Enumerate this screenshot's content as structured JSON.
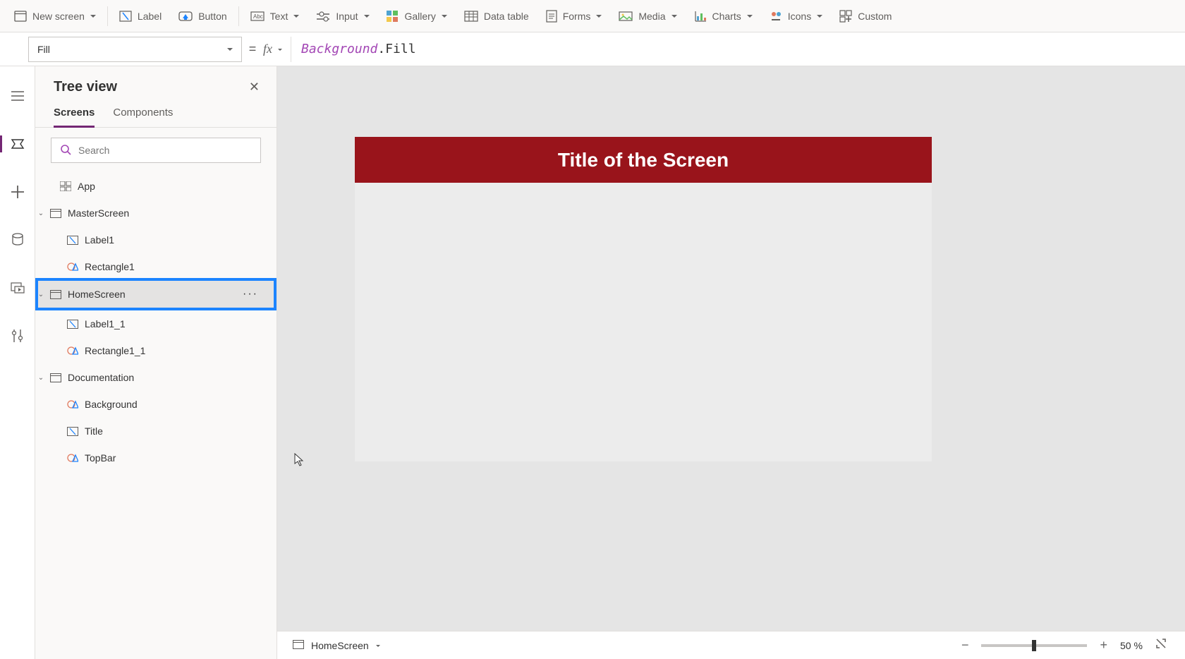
{
  "ribbon": {
    "new_screen": "New screen",
    "label": "Label",
    "button": "Button",
    "text": "Text",
    "input": "Input",
    "gallery": "Gallery",
    "data_table": "Data table",
    "forms": "Forms",
    "media": "Media",
    "charts": "Charts",
    "icons": "Icons",
    "custom": "Custom"
  },
  "property_dropdown": {
    "value": "Fill"
  },
  "formula": {
    "equals": "=",
    "fx": "fx",
    "tok1": "Background",
    "tok2": ".Fill"
  },
  "tree_view": {
    "title": "Tree view",
    "tabs": {
      "screens": "Screens",
      "components": "Components"
    },
    "search_placeholder": "Search",
    "nodes": {
      "app": "App",
      "master": "MasterScreen",
      "label1": "Label1",
      "rect1": "Rectangle1",
      "home": "HomeScreen",
      "label1_1": "Label1_1",
      "rect1_1": "Rectangle1_1",
      "doc": "Documentation",
      "bg": "Background",
      "title_ctrl": "Title",
      "topbar": "TopBar"
    },
    "more": "···"
  },
  "canvas": {
    "title": "Title of the Screen",
    "title_bg": "#99141b",
    "screen_bg": "#ececec"
  },
  "status": {
    "screen": "HomeScreen",
    "zoom_percent": "50",
    "percent_char": "%"
  }
}
